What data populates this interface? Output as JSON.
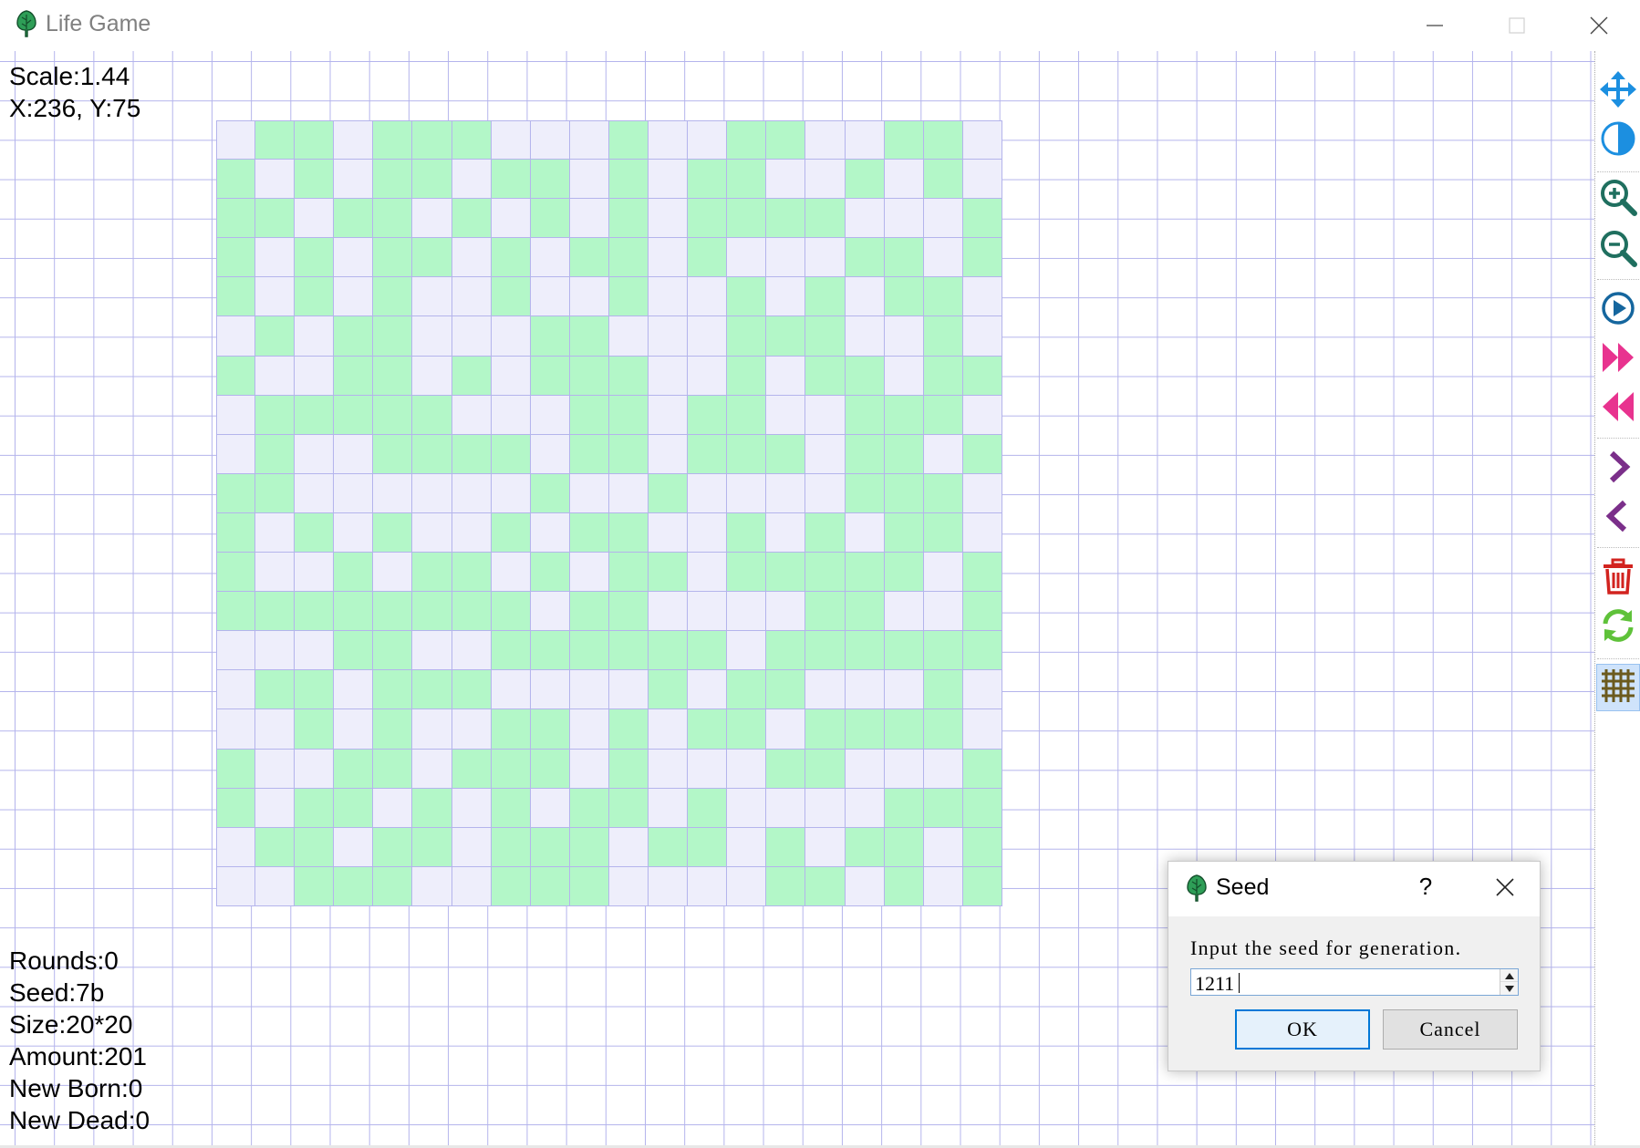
{
  "window": {
    "title": "Life Game",
    "icon": "tree-icon",
    "controls": [
      "minimize-icon",
      "maximize-icon",
      "close-icon"
    ]
  },
  "info_top": {
    "scale": "Scale:1.44",
    "coords": "X:236, Y:75"
  },
  "info_bottom": {
    "rounds": "Rounds:0",
    "seed": "Seed:7b",
    "size": "Size:20*20",
    "amount": "Amount:201",
    "new_born": "New Born:0",
    "new_dead": "New Dead:0"
  },
  "board": {
    "rows": 20,
    "cols": 20,
    "colors": {
      "alive": "#b3f7c8",
      "dead": "#eeeefb",
      "grid": "#b4b4ec"
    },
    "cells": [
      "01101110001001100110",
      "10101101101011001010",
      "11011010101011110001",
      "10101101011010001101",
      "10101001001001010110",
      "01011000110001110010",
      "10011010111001011011",
      "01111100011011001110",
      "01001111011011101101",
      "11000000100100001110",
      "10101001011001010110",
      "10010110101101111101",
      "11111111011000011001",
      "00011001111110111111",
      "01101110000101100010",
      "00101001101011011110",
      "10011011101000110001",
      "10110101011010000111",
      "01101101110110101101",
      "00111001110000110101"
    ]
  },
  "toolbar": [
    {
      "icon": "move-icon",
      "active": false
    },
    {
      "icon": "contrast-icon",
      "active": false
    },
    {
      "icon": "zoom-in-icon",
      "active": false
    },
    {
      "icon": "zoom-out-icon",
      "active": false
    },
    {
      "icon": "play-icon",
      "active": false
    },
    {
      "icon": "fast-forward-icon",
      "active": false
    },
    {
      "icon": "rewind-icon",
      "active": false
    },
    {
      "icon": "next-icon",
      "active": false
    },
    {
      "icon": "previous-icon",
      "active": false
    },
    {
      "icon": "trash-icon",
      "active": false
    },
    {
      "icon": "refresh-icon",
      "active": false
    },
    {
      "icon": "grid-icon",
      "active": true
    }
  ],
  "dialog": {
    "title": "Seed",
    "help_label": "?",
    "prompt": "Input the seed for generation.",
    "value": "1211",
    "ok_label": "OK",
    "cancel_label": "Cancel"
  }
}
